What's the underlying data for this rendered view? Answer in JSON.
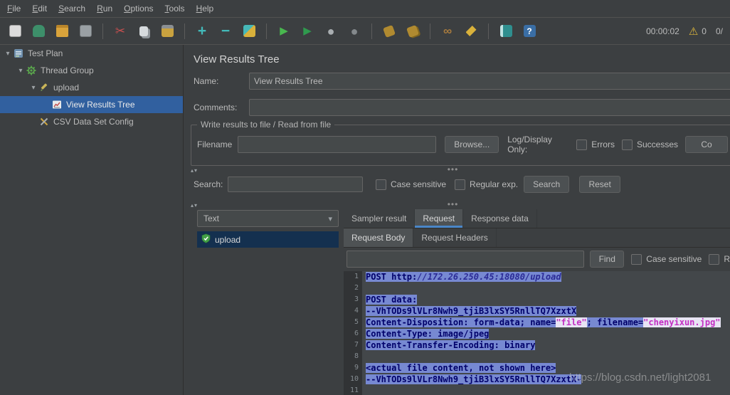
{
  "window": {
    "watermark": "https://blog.csdn.net/light2081"
  },
  "menubar": {
    "items": [
      "File",
      "Edit",
      "Search",
      "Run",
      "Options",
      "Tools",
      "Help"
    ]
  },
  "toolbar": {
    "elapsed_time": "00:00:02",
    "warning_count": "0",
    "thread_counter": "0/",
    "icons": [
      {
        "name": "new-file-icon",
        "kind": "chip chip-doc",
        "glyph": ""
      },
      {
        "name": "templates-icon",
        "kind": "chip chip-teapot",
        "glyph": ""
      },
      {
        "name": "open-file-icon",
        "kind": "chip chip-folder",
        "glyph": ""
      },
      {
        "name": "save-icon",
        "kind": "chip chip-save",
        "glyph": ""
      },
      {
        "name": "separator"
      },
      {
        "name": "cut-icon",
        "kind": "glyph-red",
        "glyph": "✂"
      },
      {
        "name": "copy-icon",
        "kind": "chip chip-copy",
        "glyph": ""
      },
      {
        "name": "paste-icon",
        "kind": "chip chip-paste",
        "glyph": ""
      },
      {
        "name": "separator"
      },
      {
        "name": "zoom-in-icon",
        "kind": "glyph-teal",
        "glyph": "+"
      },
      {
        "name": "zoom-out-icon",
        "kind": "glyph-teal",
        "glyph": "−"
      },
      {
        "name": "quill-icon",
        "kind": "chip chip-broom",
        "glyph": ""
      },
      {
        "name": "separator"
      },
      {
        "name": "start-icon",
        "kind": "glyph-green",
        "glyph": "▶"
      },
      {
        "name": "start-no-pauses-icon",
        "kind": "glyph-green2",
        "glyph": "▶"
      },
      {
        "name": "stop-icon",
        "kind": "glyph-gray",
        "glyph": "●"
      },
      {
        "name": "shutdown-icon",
        "kind": "glyph-gray2",
        "glyph": "●"
      },
      {
        "name": "separator"
      },
      {
        "name": "clear-icon",
        "kind": "chip chip-brush",
        "glyph": ""
      },
      {
        "name": "clear-all-icon",
        "kind": "chip chip-brush2",
        "glyph": ""
      },
      {
        "name": "separator"
      },
      {
        "name": "search-icon",
        "kind": "glyph-binoc",
        "glyph": "∞"
      },
      {
        "name": "search-reset-icon",
        "kind": "chip chip-wrench",
        "glyph": ""
      },
      {
        "name": "separator"
      },
      {
        "name": "function-helper-icon",
        "kind": "chip chip-fn",
        "glyph": ""
      },
      {
        "name": "help-icon",
        "kind": "chip chip-help",
        "glyph": "?"
      }
    ]
  },
  "sidebar_tree": {
    "items": [
      {
        "label": "Test Plan",
        "icon": "test-plan-icon",
        "level": 0,
        "expanded": true,
        "selected": false
      },
      {
        "label": "Thread Group",
        "icon": "thread-group-icon",
        "level": 1,
        "expanded": true,
        "selected": false
      },
      {
        "label": "upload",
        "icon": "sampler-icon",
        "level": 2,
        "expanded": true,
        "selected": false
      },
      {
        "label": "View Results Tree",
        "icon": "results-tree-icon",
        "level": 3,
        "expanded": false,
        "selected": true
      },
      {
        "label": "CSV Data Set Config",
        "icon": "csv-config-icon",
        "level": 2,
        "expanded": false,
        "selected": false
      }
    ]
  },
  "panel": {
    "title": "View Results Tree",
    "name": {
      "label": "Name:",
      "value": "View Results Tree"
    },
    "comments": {
      "label": "Comments:",
      "value": ""
    },
    "file_section": {
      "legend": "Write results to file / Read from file",
      "filename_label": "Filename",
      "filename_value": "",
      "browse_button": "Browse...",
      "log_display_label": "Log/Display Only:",
      "errors_label": "Errors",
      "successes_label": "Successes",
      "configure_button": "Co"
    },
    "search": {
      "label": "Search:",
      "value": "",
      "case_sensitive_label": "Case sensitive",
      "regular_exp_label": "Regular exp.",
      "search_button": "Search",
      "reset_button": "Reset"
    },
    "results": {
      "view_select_value": "Text",
      "result_item": {
        "label": "upload",
        "icon": "success-shield-icon"
      },
      "tabs": [
        {
          "label": "Sampler result",
          "active": false
        },
        {
          "label": "Request",
          "active": true
        },
        {
          "label": "Response data",
          "active": false
        }
      ],
      "subtabs": [
        {
          "label": "Request Body",
          "active": true
        },
        {
          "label": "Request Headers",
          "active": false
        }
      ],
      "find": {
        "value": "",
        "find_button": "Find",
        "case_sensitive_label": "Case sensitive",
        "regular_exp_label": "R"
      },
      "code": {
        "lines": [
          {
            "num": "1",
            "segments": [
              {
                "text": "POST http:",
                "style": "sel"
              },
              {
                "text": "//172.26.250.45:18080/upload",
                "style": "sel url"
              }
            ]
          },
          {
            "num": "2",
            "segments": []
          },
          {
            "num": "3",
            "segments": [
              {
                "text": "POST data:",
                "style": "sel"
              }
            ]
          },
          {
            "num": "4",
            "segments": [
              {
                "text": "--VhTODs9lVLr8Nwh9_tjiB3lxSY5RnllTQ7XzxtX",
                "style": "sel"
              }
            ]
          },
          {
            "num": "5",
            "segments": [
              {
                "text": "Content-Disposition: form-data; name=",
                "style": "sel"
              },
              {
                "text": "\"file\"",
                "style": "str"
              },
              {
                "text": "; filename=",
                "style": "sel"
              },
              {
                "text": "\"chenyixun.jpg\"",
                "style": "str"
              }
            ]
          },
          {
            "num": "6",
            "segments": [
              {
                "text": "Content-Type: image/jpeg",
                "style": "sel"
              }
            ]
          },
          {
            "num": "7",
            "segments": [
              {
                "text": "Content-Transfer-Encoding: binary",
                "style": "sel"
              }
            ]
          },
          {
            "num": "8",
            "segments": []
          },
          {
            "num": "9",
            "segments": [
              {
                "text": "<actual file content, not shown here>",
                "style": "sel"
              }
            ]
          },
          {
            "num": "10",
            "segments": [
              {
                "text": "--VhTODs9lVLr8Nwh9_tjiB3lxSY5RnllTQ7XzxtX-",
                "style": "sel"
              }
            ]
          },
          {
            "num": "11",
            "segments": []
          }
        ]
      }
    }
  }
}
